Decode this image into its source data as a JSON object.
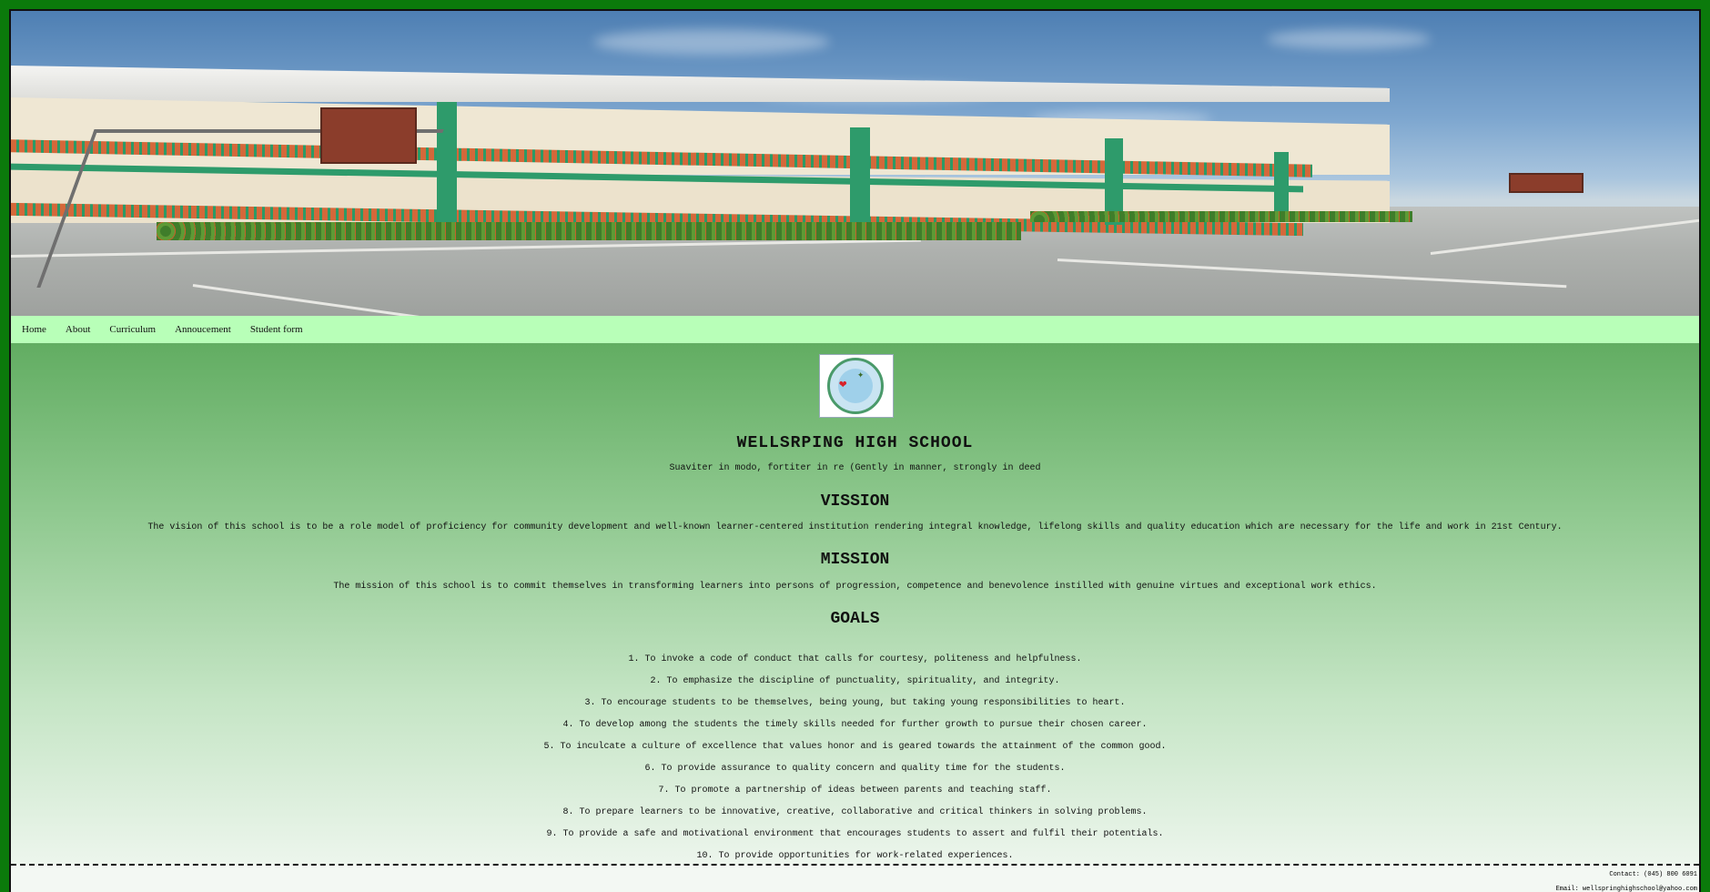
{
  "nav": {
    "items": [
      "Home",
      "About",
      "Curriculum",
      "Annoucement",
      "Student form"
    ]
  },
  "school": {
    "name": "WELLSRPING HIGH SCHOOL",
    "motto": "Suaviter in modo, fortiter in re (Gently in manner, strongly in deed"
  },
  "vission": {
    "heading": "VISSION",
    "text": "The vision of this school is to be a role model of proficiency for community development and well-known learner-centered institution rendering integral knowledge, lifelong skills and quality education which are necessary for the life and work in 21st Century."
  },
  "mission": {
    "heading": "MISSION",
    "text": "The mission of this school is to commit themselves in transforming learners into persons of progression, competence and benevolence instilled with genuine virtues and exceptional work ethics."
  },
  "goals": {
    "heading": "GOALS",
    "items": [
      "1. To invoke a code of conduct that calls for courtesy, politeness and helpfulness.",
      "2. To emphasize the discipline of punctuality, spirituality, and integrity.",
      "3. To encourage students to be themselves, being young, but taking young responsibilities to heart.",
      "4. To develop among the students the timely skills needed for further growth to pursue their chosen career.",
      "5. To inculcate a culture of excellence that values honor and is geared towards the attainment of the common good.",
      "6. To provide assurance to quality concern and quality time for the students.",
      "7. To promote a partnership of ideas between parents and teaching staff.",
      "8. To prepare learners to be innovative, creative, collaborative and critical thinkers in solving problems.",
      "9. To provide a safe and motivational environment that encourages students to assert and fulfil their potentials.",
      "10. To provide opportunities for work-related experiences."
    ]
  },
  "footer": {
    "contact": "Contact: (045) 800 6091",
    "email": "Email: wellspringhighschool@yahoo.com"
  },
  "colors": {
    "outer_border": "#0b7a0b",
    "nav_bg": "#b8ffb8",
    "content_top": "#62ad62"
  },
  "icons": {
    "logo": "school-seal-icon"
  }
}
